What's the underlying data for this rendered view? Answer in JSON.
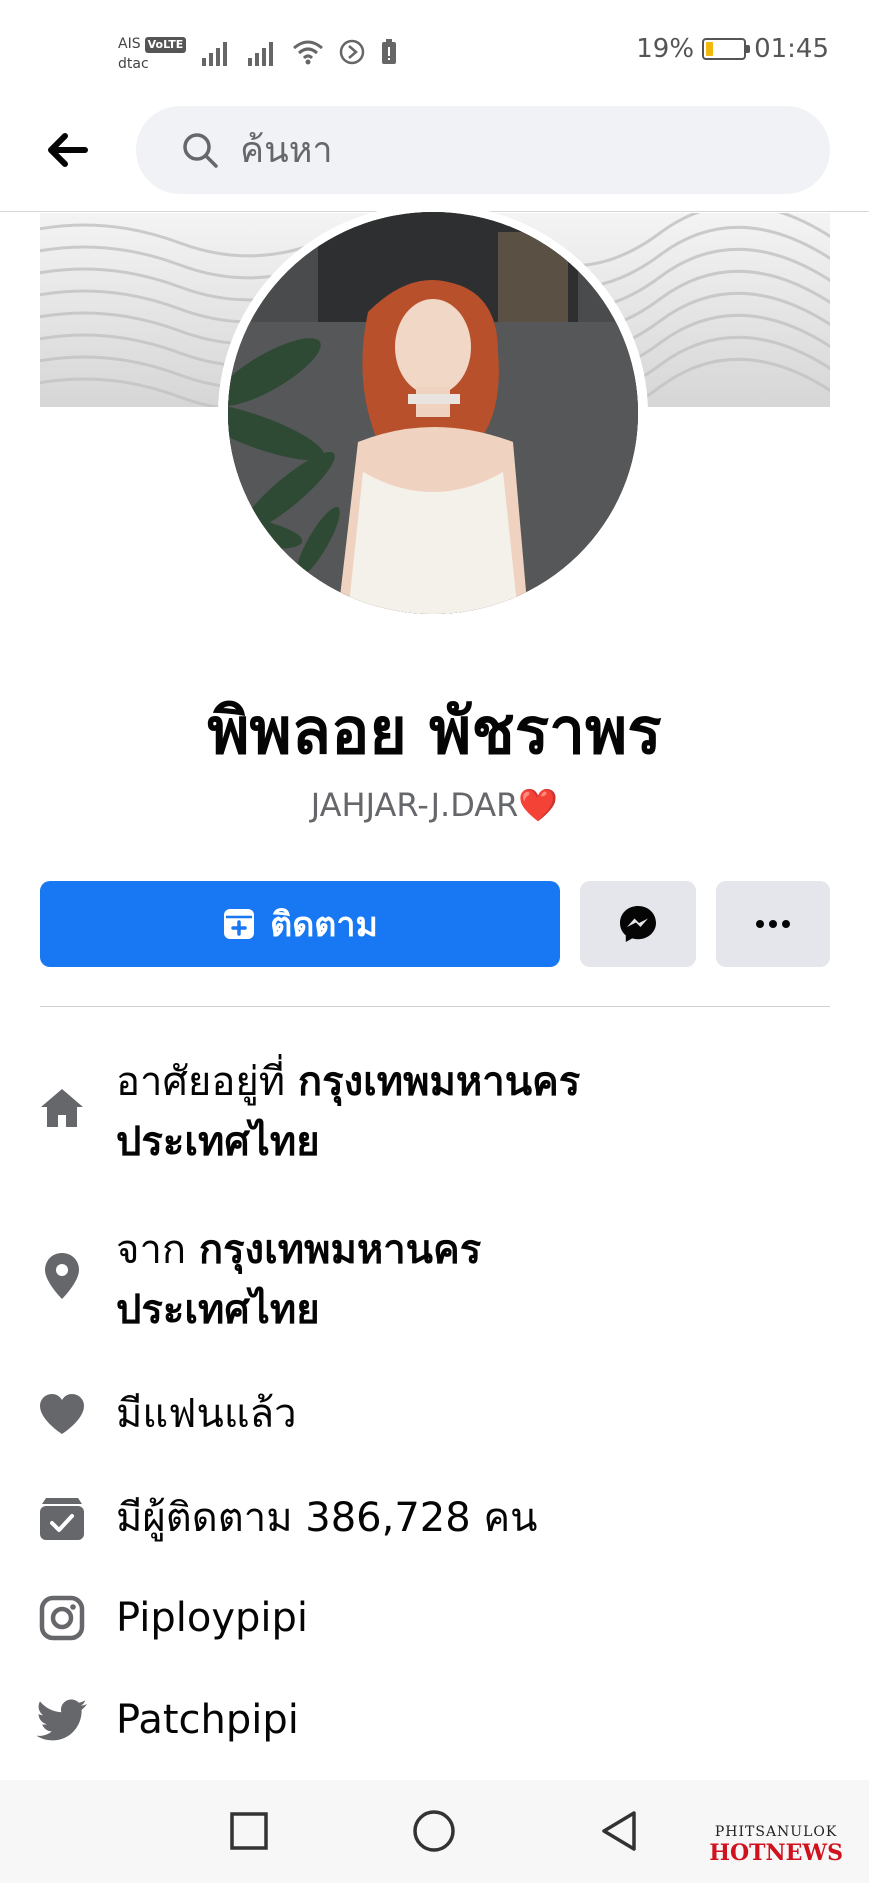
{
  "status_bar": {
    "carrier_1": "AIS",
    "volte": "VoLTE",
    "carrier_2": "dtac",
    "battery_text": "19%",
    "battery_level": 0.19,
    "time": "01:45"
  },
  "search": {
    "placeholder": "ค้นหา"
  },
  "profile": {
    "name": "พิพลอย พัชราพร",
    "subtitle": "JAHJAR-J.DAR",
    "subtitle_emoji": "❤️"
  },
  "actions": {
    "follow_label": "ติดตาม"
  },
  "intro": {
    "lives_prefix": "อาศัยอยู่ที่ ",
    "lives_city": "กรุงเทพมหานคร",
    "lives_country": "ประเทศไทย",
    "from_prefix": "จาก ",
    "from_city": "กรุงเทพมหานคร",
    "from_country": "ประเทศไทย",
    "relationship": "มีแฟนแล้ว",
    "followers": "มีผู้ติดตาม 386,728 คน",
    "instagram": "Piploypipi",
    "twitter": "Patchpipi"
  },
  "watermark": {
    "top": "PHITSANULOK",
    "bottom": "HOTNEWS"
  },
  "colors": {
    "accent": "#1877f2",
    "secondary_button": "#e4e6eb",
    "icon_gray": "#65676b",
    "heart_red": "#e41e3f"
  }
}
